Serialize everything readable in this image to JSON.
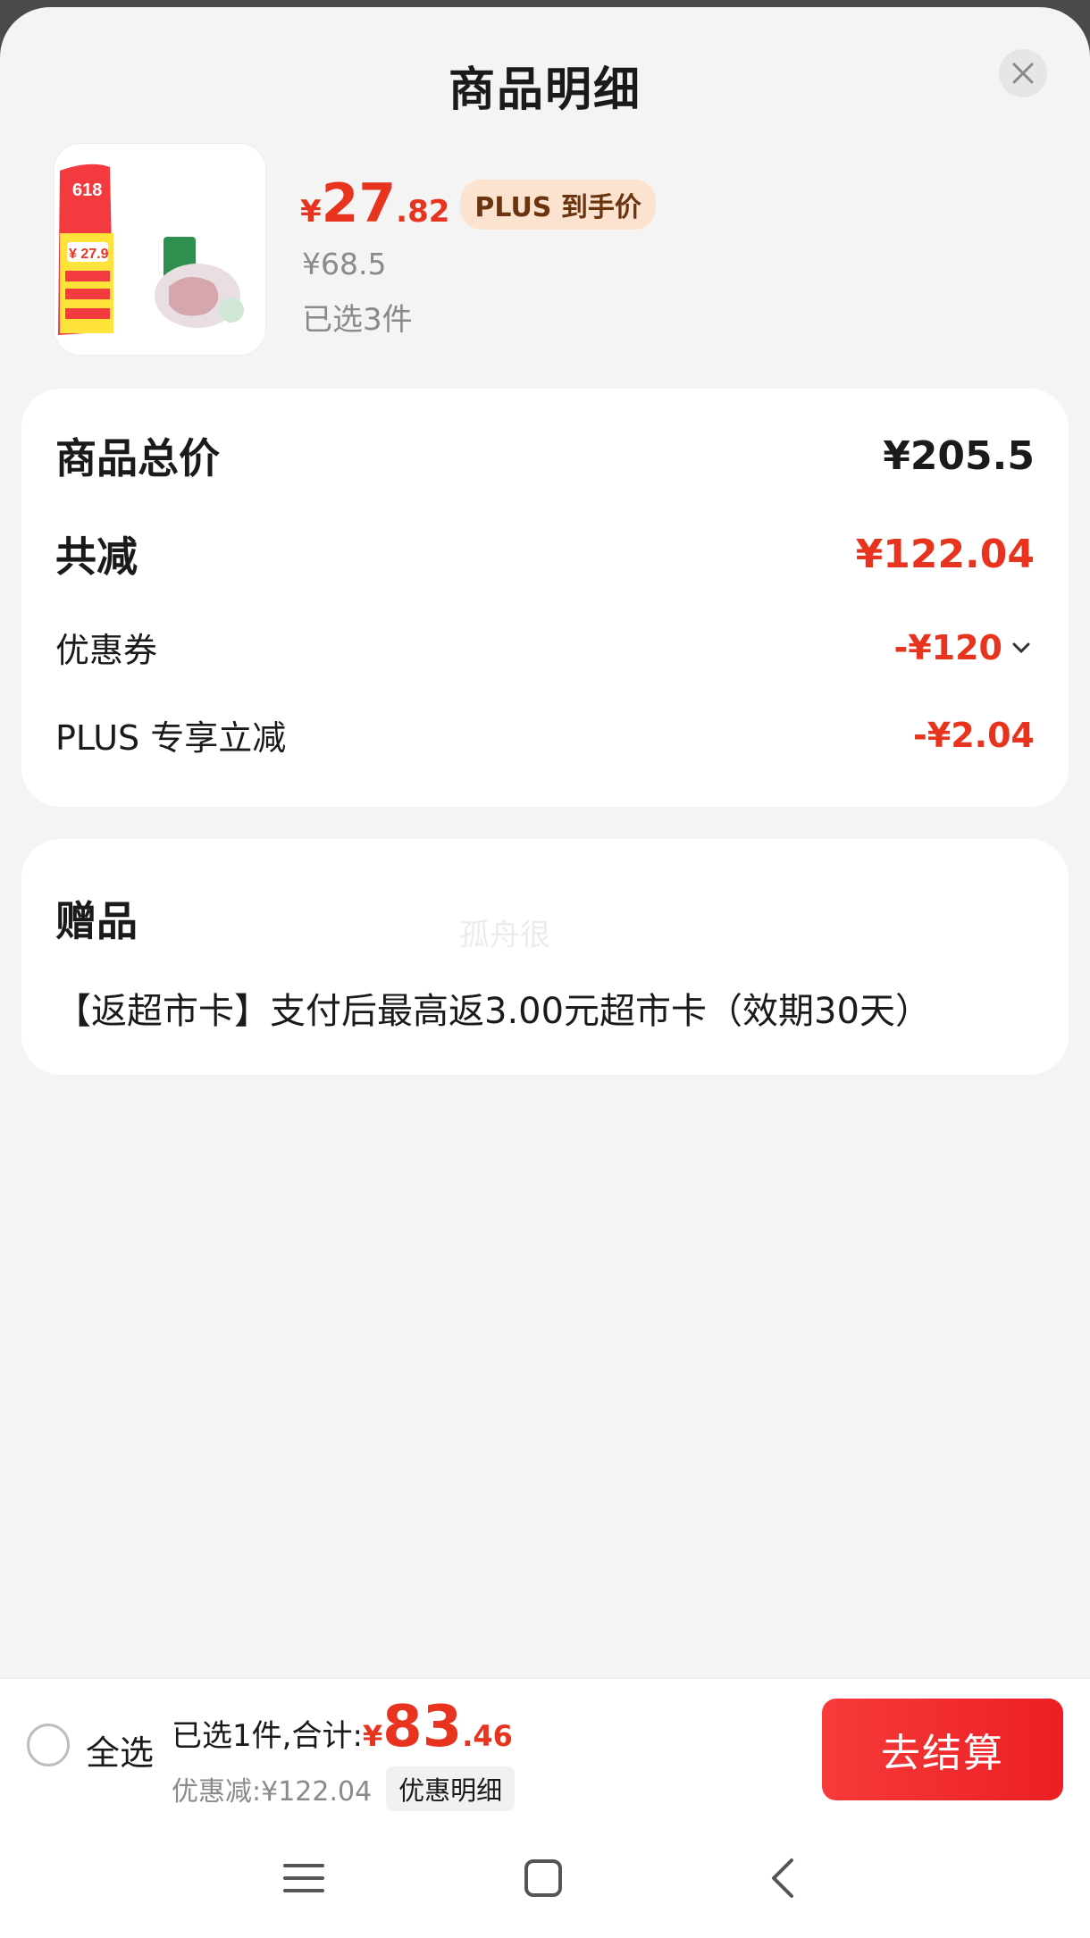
{
  "header": {
    "title": "商品明细"
  },
  "product": {
    "image_badge_text": "618",
    "image_price_text": "¥ 27.9",
    "price_yen": "¥",
    "price_int": "27",
    "price_dec": ".82",
    "plus_badge": "PLUS 到手价",
    "original_price": "¥68.5",
    "selected_count": "已选3件"
  },
  "summary": {
    "total_label": "商品总价",
    "total_value": "¥205.5",
    "reduce_label": "共减",
    "reduce_value": "¥122.04",
    "coupon_label": "优惠券",
    "coupon_value": "-¥120",
    "plus_label": "PLUS 专享立减",
    "plus_value": "-¥2.04"
  },
  "gift": {
    "title": "赠品",
    "watermark": "孤舟很",
    "text": "【返超市卡】支付后最高返3.00元超市卡（效期30天）"
  },
  "bottom": {
    "select_all": "全选",
    "sum_label": "已选1件,合计:",
    "sum_yen": "¥",
    "sum_int": "83",
    "sum_dec": ".46",
    "discount_text": "优惠减:¥122.04",
    "detail_chip": "优惠明细",
    "checkout": "去结算"
  },
  "colors": {
    "accent": "#e8331f",
    "plus_badge_bg": "#fbe3cf",
    "button": "#ec1f23"
  },
  "icons": [
    "close-icon",
    "chevron-down-icon",
    "menu-icon",
    "home-icon",
    "back-icon"
  ]
}
